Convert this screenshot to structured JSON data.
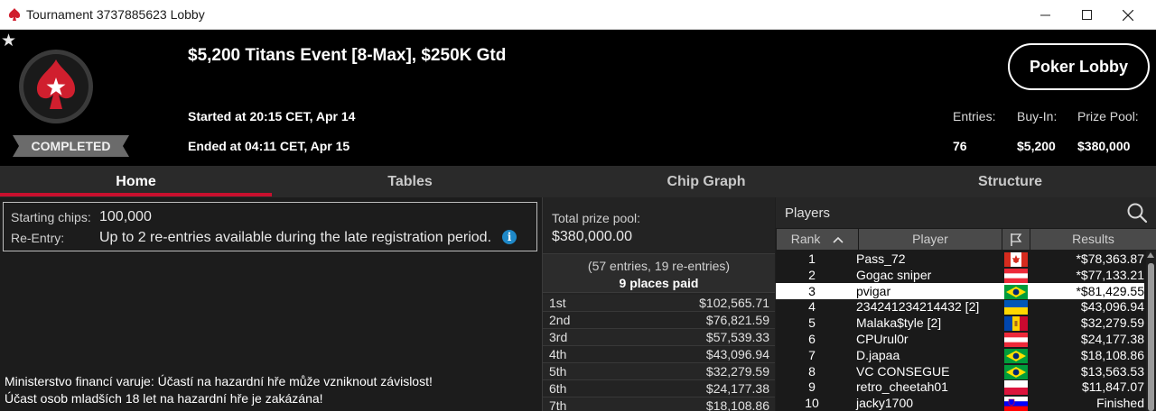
{
  "window": {
    "title": "Tournament 3737885623 Lobby"
  },
  "header": {
    "status": "COMPLETED",
    "event_title": "$5,200 Titans Event [8-Max], $250K Gtd",
    "started": "Started at 20:15 CET, Apr 14",
    "ended": "Ended at 04:11 CET, Apr 15",
    "poker_lobby_label": "Poker Lobby",
    "stats": {
      "entries_label": "Entries:",
      "entries": "76",
      "buyin_label": "Buy-In:",
      "buyin": "$5,200",
      "prize_label": "Prize Pool:",
      "prize": "$380,000"
    }
  },
  "tabs": [
    "Home",
    "Tables",
    "Chip Graph",
    "Structure"
  ],
  "home": {
    "starting_chips_label": "Starting chips:",
    "starting_chips": "100,000",
    "reentry_label": "Re-Entry:",
    "reentry": "Up to 2 re-entries available during the late registration period.",
    "info_glyph": "i",
    "disclaimer_1": "Ministerstvo financí varuje: Účastí na hazardní hře může vzniknout závislost!",
    "disclaimer_2": "Účast osob mladších 18 let na hazardní hře je zakázána!"
  },
  "prize_pool": {
    "label": "Total prize pool:",
    "value": "$380,000.00",
    "entries_text": "(57 entries, 19 re-entries)",
    "places_paid": "9 places paid",
    "payouts": [
      {
        "place": "1st",
        "amount": "$102,565.71"
      },
      {
        "place": "2nd",
        "amount": "$76,821.59"
      },
      {
        "place": "3rd",
        "amount": "$57,539.33"
      },
      {
        "place": "4th",
        "amount": "$43,096.94"
      },
      {
        "place": "5th",
        "amount": "$32,279.59"
      },
      {
        "place": "6th",
        "amount": "$24,177.38"
      },
      {
        "place": "7th",
        "amount": "$18,108.86"
      }
    ]
  },
  "players": {
    "title": "Players",
    "columns": {
      "rank": "Rank",
      "player": "Player",
      "results": "Results"
    },
    "rows": [
      {
        "rank": "1",
        "name": "Pass_72",
        "flag": "canada",
        "result": "*$78,363.87"
      },
      {
        "rank": "2",
        "name": "Gogac sniper",
        "flag": "austria",
        "result": "*$77,133.21"
      },
      {
        "rank": "3",
        "name": "pvigar",
        "flag": "brazil",
        "result": "*$81,429.55",
        "selected": true
      },
      {
        "rank": "4",
        "name": "234241234214432 [2]",
        "flag": "ukraine",
        "result": "$43,096.94"
      },
      {
        "rank": "5",
        "name": "Malaka$tyle [2]",
        "flag": "moldova",
        "result": "$32,279.59"
      },
      {
        "rank": "6",
        "name": "CPUrul0r",
        "flag": "austria",
        "result": "$24,177.38"
      },
      {
        "rank": "7",
        "name": "D.japaa",
        "flag": "brazil",
        "result": "$18,108.86"
      },
      {
        "rank": "8",
        "name": "VC CONSEGUE",
        "flag": "brazil",
        "result": "$13,563.53"
      },
      {
        "rank": "9",
        "name": "retro_cheetah01",
        "flag": "poland",
        "result": "$11,847.07"
      },
      {
        "rank": "10",
        "name": "jacky1700",
        "flag": "slovenia",
        "result": "Finished"
      }
    ]
  },
  "colors": {
    "accent": "#c8102e",
    "header_bg": "#000000",
    "panel_bg": "#1e1e1e"
  }
}
